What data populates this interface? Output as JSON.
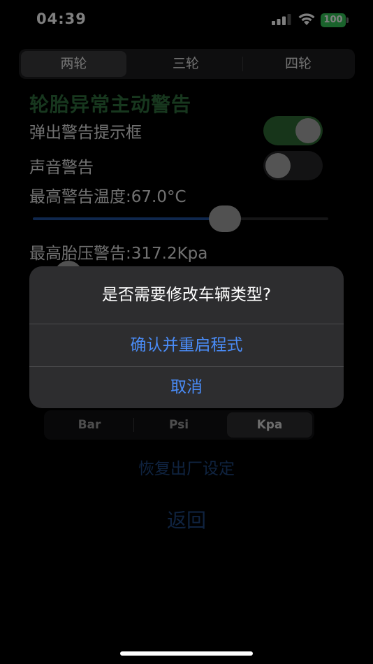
{
  "status_bar": {
    "time": "04:39",
    "battery": "100",
    "icons": [
      "signal-icon",
      "wifi-icon",
      "battery-icon"
    ]
  },
  "wheel_selector": {
    "options": [
      "两轮",
      "三轮",
      "四轮"
    ],
    "selected": "两轮"
  },
  "settings": {
    "section_title": "轮胎异常主动警告",
    "popup_label": "弹出警告提示框",
    "popup_enabled": true,
    "sound_label": "声音警告",
    "sound_enabled": false,
    "max_temp_label": "最高警告温度:67.0°C",
    "max_temp_slider_fraction": 0.65,
    "max_pressure_label": "最高胎压警告:317.2Kpa"
  },
  "unit_selector": {
    "options": [
      "Bar",
      "Psi",
      "Kpa"
    ],
    "selected": "Kpa"
  },
  "actions": {
    "reset_label": "恢复出厂设定",
    "back_label": "返回"
  },
  "alert": {
    "title": "是否需要修改车辆类型?",
    "confirm_label": "确认并重启程式",
    "cancel_label": "取消"
  },
  "colors": {
    "accent_blue": "#4a8cf7",
    "toggle_on_green": "#2e6b34",
    "section_title_green": "#2f6e3c",
    "battery_green": "#34c759"
  }
}
